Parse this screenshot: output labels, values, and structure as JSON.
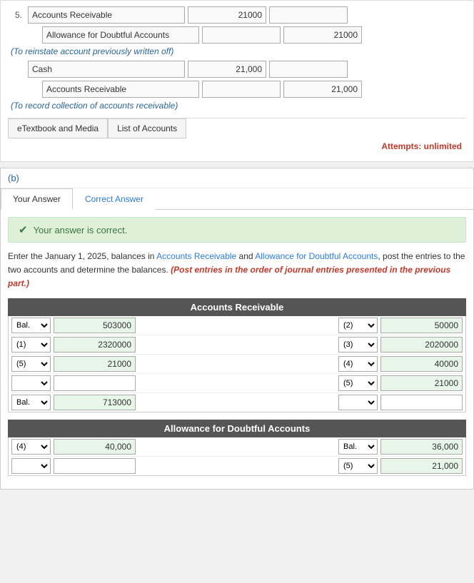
{
  "top": {
    "item_num": "5.",
    "rows": [
      {
        "label": "Accounts Receivable",
        "debit": "21000",
        "credit": ""
      },
      {
        "label": "Allowance for Doubtful Accounts",
        "debit": "",
        "credit": "21000"
      }
    ],
    "note1": "(To reinstate account previously written off)",
    "rows2": [
      {
        "label": "Cash",
        "debit": "21,000",
        "credit": ""
      },
      {
        "label": "Accounts Receivable",
        "debit": "",
        "credit": "21,000"
      }
    ],
    "note2": "(To record collection of accounts receivable)",
    "links": [
      "eTextbook and Media",
      "List of Accounts"
    ],
    "attempts_label": "Attempts:",
    "attempts_value": "unlimited"
  },
  "section_b": {
    "label": "(b)",
    "tabs": [
      "Your Answer",
      "Correct Answer"
    ],
    "active_tab": 0,
    "correct_message": "Your answer is correct.",
    "description": "Enter the January 1, 2025, balances in Accounts Receivable and Allowance for Doubtful Accounts, post the entries to the two accounts and determine the balances.",
    "description_italic": "(Post entries in the order of journal entries presented in the previous part.)",
    "accounts_receivable": {
      "title": "Accounts Receivable",
      "rows": [
        {
          "left_label": "Bal.",
          "left_amount": "503000",
          "right_label": "(2)",
          "right_amount": "50000"
        },
        {
          "left_label": "(1)",
          "left_amount": "2320000",
          "right_label": "(3)",
          "right_amount": "2020000"
        },
        {
          "left_label": "(5)",
          "left_amount": "21000",
          "right_label": "(4)",
          "right_amount": "40000"
        },
        {
          "left_label": "",
          "left_amount": "",
          "right_label": "(5)",
          "right_amount": "21000"
        },
        {
          "left_label": "Bal.",
          "left_amount": "713000",
          "right_label": "",
          "right_amount": ""
        }
      ]
    },
    "allowance": {
      "title": "Allowance for Doubtful Accounts",
      "rows": [
        {
          "left_label": "(4)",
          "left_amount": "40,000",
          "right_label": "Bal.",
          "right_amount": "36,000"
        },
        {
          "left_label": "",
          "left_amount": "",
          "right_label": "(5)",
          "right_amount": "21,000"
        }
      ]
    }
  }
}
